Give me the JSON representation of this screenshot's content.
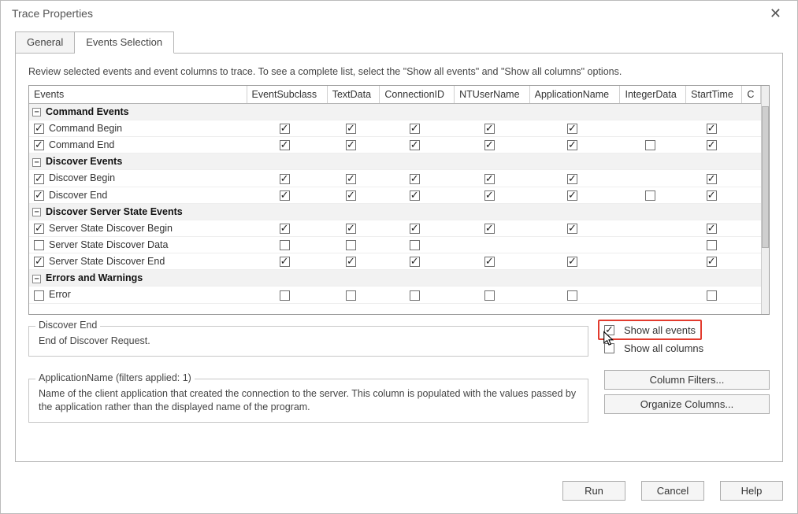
{
  "window": {
    "title": "Trace Properties"
  },
  "tabs": {
    "general": "General",
    "events": "Events Selection"
  },
  "instructions": "Review selected events and event columns to trace. To see a complete list, select the \"Show all events\" and \"Show all columns\" options.",
  "columns": [
    "Events",
    "EventSubclass",
    "TextData",
    "ConnectionID",
    "NTUserName",
    "ApplicationName",
    "IntegerData",
    "StartTime",
    "C"
  ],
  "rows": [
    {
      "type": "group",
      "label": "Command Events",
      "expanded": true
    },
    {
      "type": "item",
      "label": "Command Begin",
      "sel": true,
      "cells": [
        true,
        true,
        true,
        true,
        true,
        null,
        true
      ]
    },
    {
      "type": "item",
      "label": "Command End",
      "sel": true,
      "cells": [
        true,
        true,
        true,
        true,
        true,
        false,
        true
      ]
    },
    {
      "type": "group",
      "label": "Discover Events",
      "expanded": true
    },
    {
      "type": "item",
      "label": "Discover Begin",
      "sel": true,
      "cells": [
        true,
        true,
        true,
        true,
        true,
        null,
        true
      ]
    },
    {
      "type": "item",
      "label": "Discover End",
      "sel": true,
      "cells": [
        true,
        true,
        true,
        true,
        true,
        false,
        true
      ]
    },
    {
      "type": "group",
      "label": "Discover Server State Events",
      "expanded": true
    },
    {
      "type": "item",
      "label": "Server State Discover Begin",
      "sel": true,
      "cells": [
        true,
        true,
        true,
        true,
        true,
        null,
        true
      ]
    },
    {
      "type": "item",
      "label": "Server State Discover Data",
      "sel": false,
      "cells": [
        false,
        false,
        false,
        null,
        null,
        null,
        false
      ]
    },
    {
      "type": "item",
      "label": "Server State Discover End",
      "sel": true,
      "cells": [
        true,
        true,
        true,
        true,
        true,
        null,
        true
      ]
    },
    {
      "type": "group",
      "label": "Errors and Warnings",
      "expanded": true
    },
    {
      "type": "item",
      "label": "Error",
      "sel": false,
      "cells": [
        false,
        false,
        false,
        false,
        false,
        null,
        false
      ]
    }
  ],
  "detail": {
    "title": "Discover End",
    "text": "End of Discover Request."
  },
  "sideChecks": {
    "showAllEvents": {
      "label": "Show all events",
      "checked": true
    },
    "showAllColumns": {
      "label": "Show all columns",
      "checked": false
    }
  },
  "filterBox": {
    "title": "ApplicationName (filters applied: 1)",
    "text": "Name of the client application that created the connection to the server. This column is populated with the values passed by the application rather than the displayed name of the program."
  },
  "buttons": {
    "columnFilters": "Column Filters...",
    "organizeColumns": "Organize Columns...",
    "run": "Run",
    "cancel": "Cancel",
    "help": "Help"
  }
}
